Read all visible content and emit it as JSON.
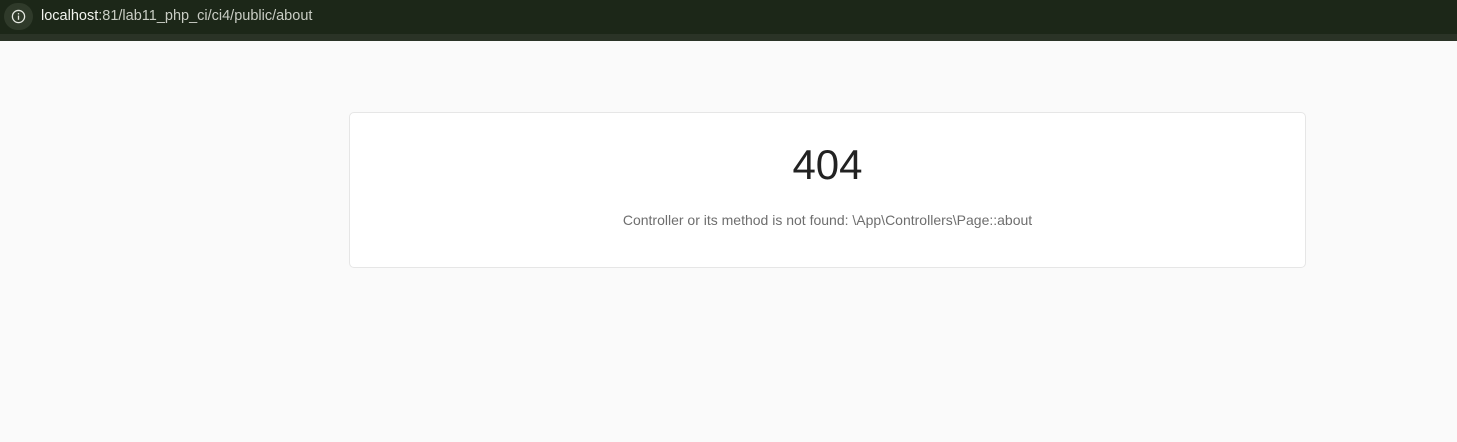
{
  "browser": {
    "address_host": "localhost",
    "address_path": ":81/lab11_php_ci/ci4/public/about",
    "info_icon": "info-circle-icon"
  },
  "error_page": {
    "code": "404",
    "message": "Controller or its method is not found: \\App\\Controllers\\Page::about"
  },
  "colors": {
    "toolbar_bg": "#1c2718",
    "page_bg": "#fafafa",
    "card_bg": "#ffffff",
    "code_text": "#222222",
    "message_text": "#6e6e6e"
  }
}
